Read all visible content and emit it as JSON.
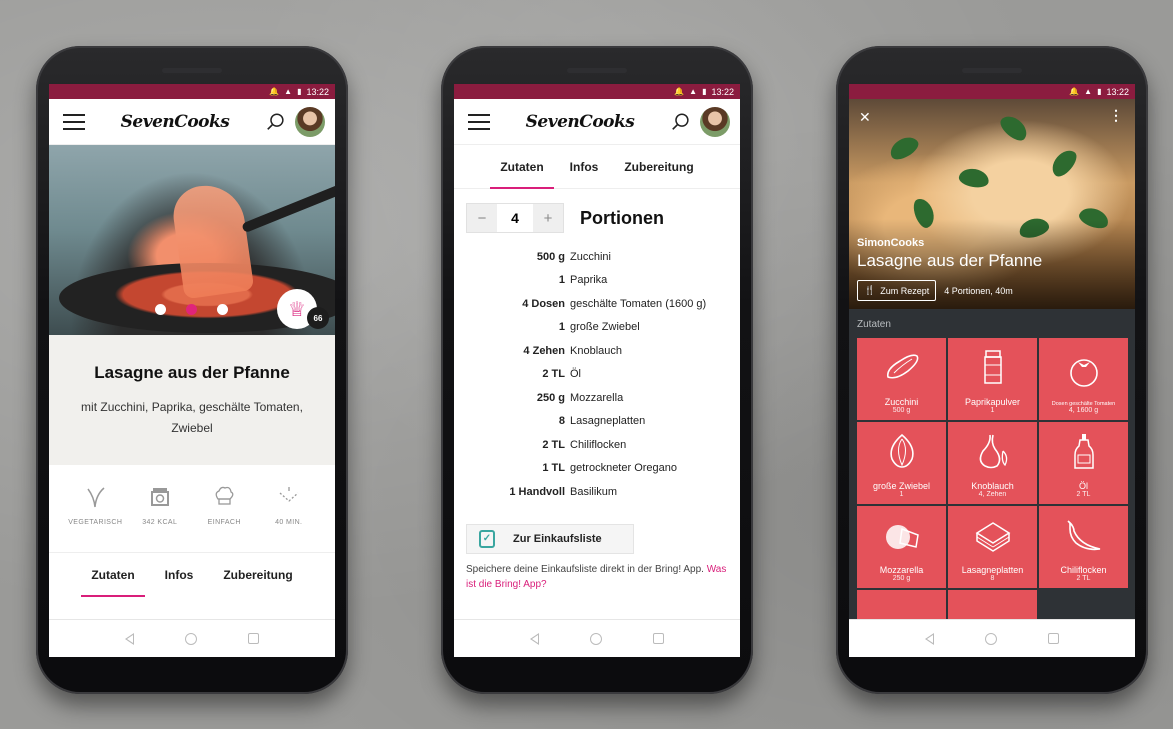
{
  "status": {
    "time": "13:22"
  },
  "app": {
    "logo": "SevenCooks"
  },
  "recipe": {
    "title": "Lasagne aus der Pfanne",
    "subtitle": "mit Zucchini, Paprika, geschälte Tomaten, Zwiebel",
    "author": "SimonCooks",
    "rating_count": "66",
    "properties": [
      {
        "icon": "leaf-icon",
        "label": "VEGETARISCH"
      },
      {
        "icon": "scale-icon",
        "label": "342 KCAL"
      },
      {
        "icon": "chef-hat-icon",
        "label": "EINFACH"
      },
      {
        "icon": "timer-icon",
        "label": "40 MIN."
      }
    ]
  },
  "tabs": [
    "Zutaten",
    "Infos",
    "Zubereitung"
  ],
  "portions": {
    "value": "4",
    "label": "Portionen",
    "minus": "−",
    "plus": "+"
  },
  "ingredients": [
    {
      "amount": "500 g",
      "name": "Zucchini"
    },
    {
      "amount": "1",
      "name": "Paprika"
    },
    {
      "amount": "4 Dosen",
      "name": "geschälte Tomaten (1600 g)"
    },
    {
      "amount": "1",
      "name": "große Zwiebel"
    },
    {
      "amount": "4 Zehen",
      "name": "Knoblauch"
    },
    {
      "amount": "2 TL",
      "name": "Öl"
    },
    {
      "amount": "250 g",
      "name": "Mozzarella"
    },
    {
      "amount": "8",
      "name": "Lasagneplatten"
    },
    {
      "amount": "2 TL",
      "name": "Chiliflocken"
    },
    {
      "amount": "1 TL",
      "name": "getrockneter Oregano"
    },
    {
      "amount": "1 Handvoll",
      "name": "Basilikum"
    }
  ],
  "shopping": {
    "button": "Zur Einkaufsliste",
    "text": "Speichere deine Einkaufsliste direkt in der Bring! App.",
    "link": "Was ist die Bring! App?"
  },
  "detail": {
    "button": "Zum Rezept",
    "meta": "4 Portionen, 40m",
    "section": "Zutaten",
    "tiles": [
      {
        "name": "Zucchini",
        "qty": "500 g",
        "icon": "zucchini-icon"
      },
      {
        "name": "Paprikapulver",
        "qty": "1",
        "icon": "spice-jar-icon"
      },
      {
        "name": "Dosen geschälte Tomaten",
        "qty": "4, 1600 g",
        "icon": "tomato-icon",
        "small": true
      },
      {
        "name": "große Zwiebel",
        "qty": "1",
        "icon": "onion-icon"
      },
      {
        "name": "Knoblauch",
        "qty": "4, Zehen",
        "icon": "garlic-icon"
      },
      {
        "name": "Öl",
        "qty": "2 TL",
        "icon": "oil-bottle-icon"
      },
      {
        "name": "Mozzarella",
        "qty": "250 g",
        "icon": "cheese-icon"
      },
      {
        "name": "Lasagneplatten",
        "qty": "8",
        "icon": "lasagna-icon"
      },
      {
        "name": "Chiliflocken",
        "qty": "2 TL",
        "icon": "chili-icon"
      }
    ]
  }
}
